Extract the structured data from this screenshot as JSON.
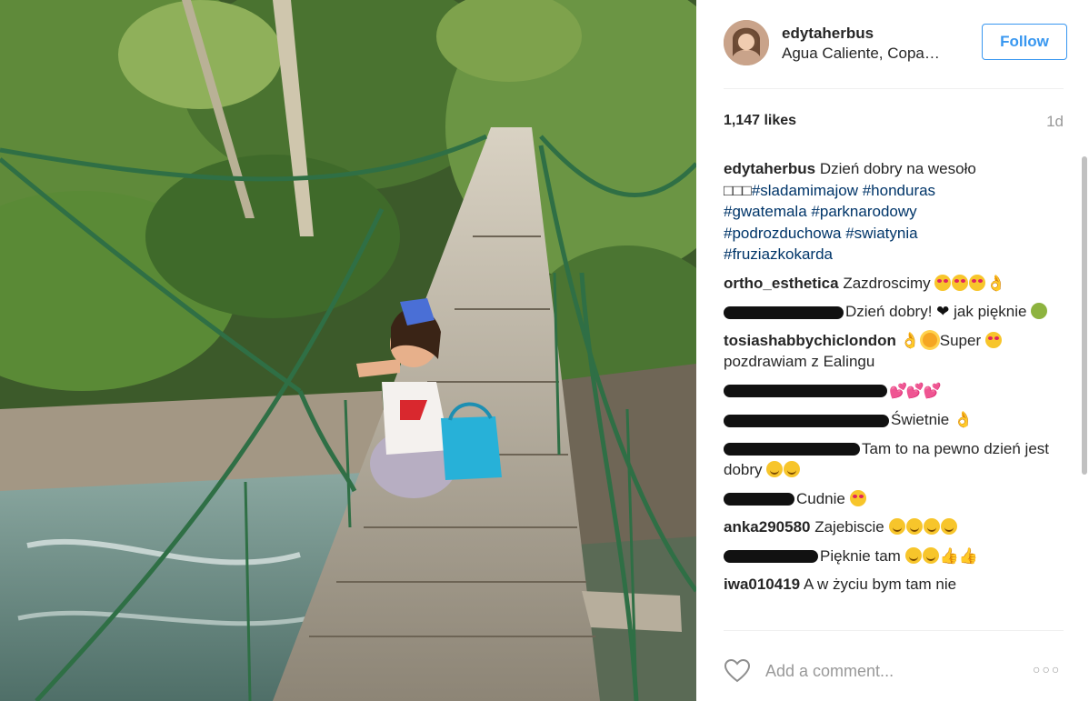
{
  "post": {
    "username": "edytaherbus",
    "location": "Agua Caliente, Copa…",
    "follow_label": "Follow",
    "likes": "1,147 likes",
    "time": "1d"
  },
  "comments": [
    {
      "user": "edytaherbus",
      "text": "Dzień dobry na wesoło",
      "glyphs": "□□□",
      "tags": [
        "#sladamimajow",
        "#honduras",
        "#gwatemala",
        "#parknarodowy",
        "#podrozduchowa",
        "#swiatynia",
        "#fruziazkokarda"
      ]
    },
    {
      "user": "ortho_esthetica",
      "text": "Zazdroscimy"
    },
    {
      "text1": "Dzień dobry! ",
      "text2": " jak pięknie"
    },
    {
      "user": "tosiashabbychiclondon",
      "text": "Super",
      "text2": "pozdrawiam z Ealingu"
    },
    {
      "text": ""
    },
    {
      "text": "Świetnie"
    },
    {
      "text": "Tam to na pewno dzień jest dobry"
    },
    {
      "text": "Cudnie"
    },
    {
      "user": "anka290580",
      "text": "Zajebiscie"
    },
    {
      "text": "Pięknie tam"
    },
    {
      "user": "iwa010419",
      "text": "A w życiu bym tam nie"
    }
  ],
  "comment_box": {
    "placeholder": "Add a comment..."
  },
  "icons": {
    "heart": "heart-outline-icon",
    "more": "more-options-icon"
  },
  "colors": {
    "accent": "#3897f0",
    "hashtag": "#003569",
    "muted": "#999999"
  }
}
